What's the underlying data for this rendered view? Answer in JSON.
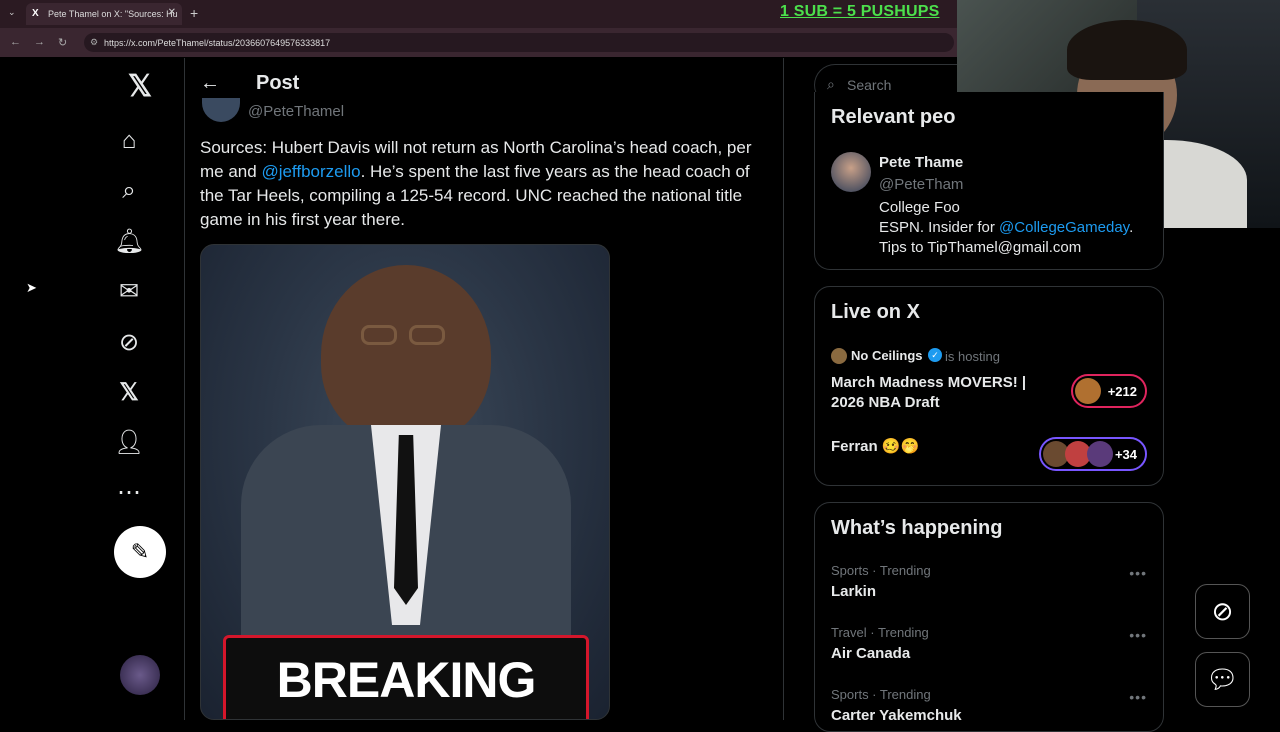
{
  "browser": {
    "tab_title": "Pete Thamel on X: \"Sources: Hu",
    "tab_x_icon": "X",
    "url": "https://x.com/PeteThamel/status/2036607649576333817",
    "promo_text": "1 SUB = 5 PUSHUPS"
  },
  "header": {
    "title": "Post"
  },
  "post": {
    "handle": "@PeteThamel",
    "text_1": "Sources: Hubert Davis will not return as North Carolina’s head coach, per me and ",
    "mention": "@jeffborzello",
    "text_2": ". He’s spent the last five years as the head coach of the Tar Heels, compiling a 125-54 record. UNC reached the national title game in his first year there.",
    "image_banner": "BREAKING NEWS"
  },
  "search": {
    "placeholder": "Search"
  },
  "relevant": {
    "title": "Relevant peo",
    "name": "Pete Thame",
    "handle": "@PeteTham",
    "bio_1": "College Foo",
    "bio_mention": "@CollegeGameday",
    "bio_2": "ESPN. Insider for ",
    "bio_3": ".",
    "bio_4": "Tips to TipThamel@gmail.com"
  },
  "live": {
    "title": "Live on X",
    "host": "No Ceilings",
    "hosting": "is hosting",
    "space1_title": "March Madness MOVERS! | 2026 NBA Draft",
    "space1_count": "+212",
    "space2_title": "Ferran 🥴🤭",
    "space2_count": "+34"
  },
  "happening": {
    "title": "What’s happening",
    "items": [
      {
        "meta": "Sports · Trending",
        "name": "Larkin"
      },
      {
        "meta": "Travel · Trending",
        "name": "Air Canada"
      },
      {
        "meta": "Sports · Trending",
        "name": "Carter Yakemchuk"
      }
    ]
  },
  "colors": {
    "accent": "#1d9bf0",
    "promo": "#4ce04c",
    "breaking": "#d4162b"
  }
}
